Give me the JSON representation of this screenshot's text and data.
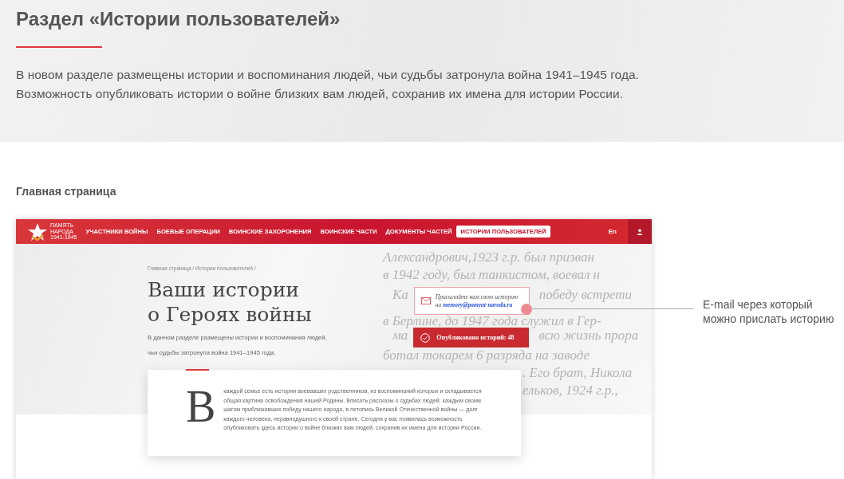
{
  "section": {
    "title": "Раздел «Истории пользователей»",
    "paragraph_lines": [
      "В новом разделе размещены истории и воспоминания людей, чьи судьбы затронула война 1941–1945 года.",
      "Возможность опубликовать истории о войне близких вам людей, сохранив их имена для истории России."
    ]
  },
  "subheading": "Главная страница",
  "mockup": {
    "logo": {
      "name_lines": [
        "ПАМЯТЬ",
        "НАРОДА"
      ],
      "years": "1941-1945"
    },
    "nav": [
      {
        "label": "УЧАСТНИКИ ВОЙНЫ",
        "selected": false
      },
      {
        "label": "БОЕВЫЕ ОПЕРАЦИИ",
        "selected": false
      },
      {
        "label": "ВОИНСКИЕ ЗАХОРОНЕНИЯ",
        "selected": false
      },
      {
        "label": "ВОИНСКИЕ ЧАСТИ",
        "selected": false
      },
      {
        "label": "ДОКУМЕНТЫ ЧАСТЕЙ",
        "selected": false
      },
      {
        "label": "ИСТОРИИ ПОЛЬЗОВАТЕЛЕЙ",
        "selected": true
      }
    ],
    "language": "En",
    "breadcrumb": "Главная страница / Истории пользователей /",
    "title_lines": [
      "Ваши истории",
      "о Героях войны"
    ],
    "description_lines": [
      "В данном разделе размещены истории и воспоминания людей,",
      "чьи судьбы затронула война 1941–1945 года."
    ],
    "email_box": {
      "text": "Присылайте нам свою историю",
      "prefix": "на",
      "email": "memory@pamyat-naroda.ru"
    },
    "published_counter": "Опубликовано историй: 48",
    "background_text": [
      {
        "kind": "full",
        "left": "Александрович,1923 г.р. был призван"
      },
      {
        "kind": "full",
        "left": "в 1942 году, был танкистом, воевал н"
      },
      {
        "kind": "around_email",
        "left": "Ка",
        "right": "победу встрети"
      },
      {
        "kind": "full",
        "left": "в Берлине, до 1947 года служил в Гер-"
      },
      {
        "kind": "around_counter",
        "left": "ма",
        "right": "всю жизнь прора"
      },
      {
        "kind": "full",
        "left": "ботал токарем 6 разряда на заводе"
      },
      {
        "kind": "right_of_card",
        "right": ". Его брат, Никола"
      },
      {
        "kind": "right_of_card",
        "right": "ельков, 1924 г.р.,"
      }
    ],
    "intro": {
      "drop_cap": "В",
      "text": "каждой семье есть истории воевавших родственников, из воспоминаний которых и складывается общая картина освобождения нашей Родины. Вписать рассказы о судьбах людей, каждым своим шагом приближавших победу нашего народа, в летопись Великой Отечественной войны — долг каждого человека, неравнодушного к своей стране. Сегодня у вас появилась возможность опубликовать здесь истории о войне близких вам людей, сохранив их имена для истории России."
    }
  },
  "annotation": {
    "text": "E-mail через который можно прислать историю"
  }
}
